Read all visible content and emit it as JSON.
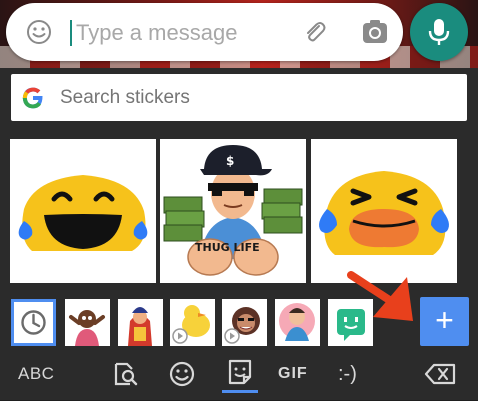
{
  "compose": {
    "placeholder": "Type a message"
  },
  "sticker_search": {
    "placeholder": "Search stickers"
  },
  "stickers": [
    {
      "name": "laughing-blob-sticker"
    },
    {
      "name": "thug-life-sticker",
      "caption": "THUG LIFE"
    },
    {
      "name": "crying-blob-sticker"
    }
  ],
  "tray": {
    "items": [
      "recent",
      "pack-1",
      "pack-2",
      "pack-3",
      "pack-4",
      "pack-5",
      "pack-6"
    ],
    "add_label": "+"
  },
  "bottom_bar": {
    "abc_label": "ABC",
    "gif_label": "GIF",
    "emoticon_label": ":-)"
  },
  "colors": {
    "accent_teal": "#1a8c7e",
    "accent_blue": "#4f8ef0",
    "arrow_orange": "#e8401c",
    "keyboard_bg": "#2b2b2b"
  }
}
